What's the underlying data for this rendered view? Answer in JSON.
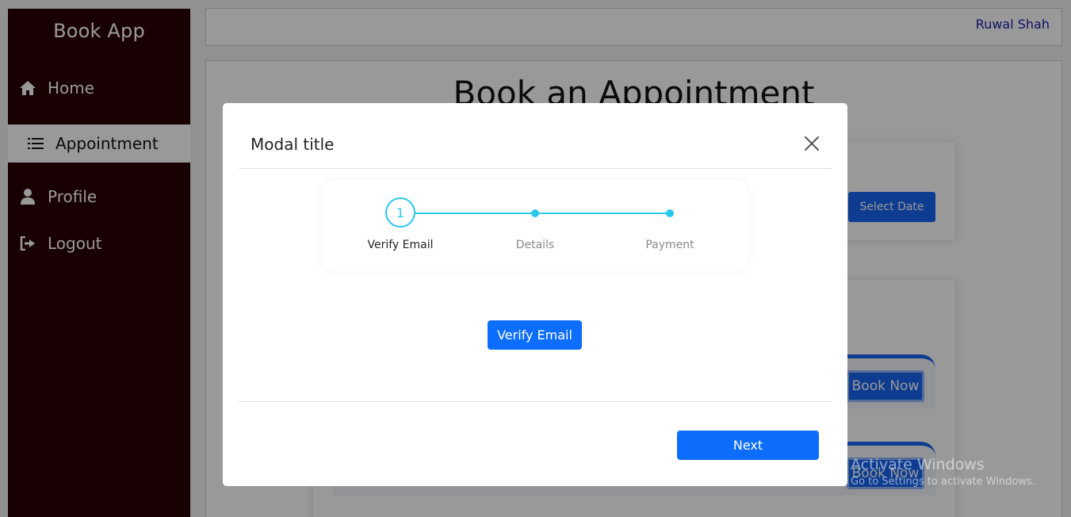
{
  "sidebar": {
    "brand": "Book App",
    "items": [
      {
        "label": "Home",
        "icon": "home-icon"
      },
      {
        "label": "Appointment",
        "icon": "list-icon"
      },
      {
        "label": "Profile",
        "icon": "user-icon"
      },
      {
        "label": "Logout",
        "icon": "logout-icon"
      }
    ]
  },
  "header": {
    "user_name": "Ruwal Shah"
  },
  "main": {
    "heading": "Book an Appointment",
    "select_date_label": "Select Date",
    "book_now_label": "Book Now"
  },
  "modal": {
    "title": "Modal title",
    "steps": [
      {
        "label": "Verify Email",
        "number": "1",
        "active": true
      },
      {
        "label": "Details",
        "active": false
      },
      {
        "label": "Payment",
        "active": false
      }
    ],
    "verify_button_label": "Verify Email",
    "next_button_label": "Next"
  },
  "watermark": {
    "title": "Activate Windows",
    "subtitle": "Go to Settings to activate Windows."
  },
  "colors": {
    "sidebar_bg": "#2a0205",
    "primary": "#0d6efd",
    "step_accent": "#2cc7ee",
    "user_link": "#1a1aaa"
  }
}
